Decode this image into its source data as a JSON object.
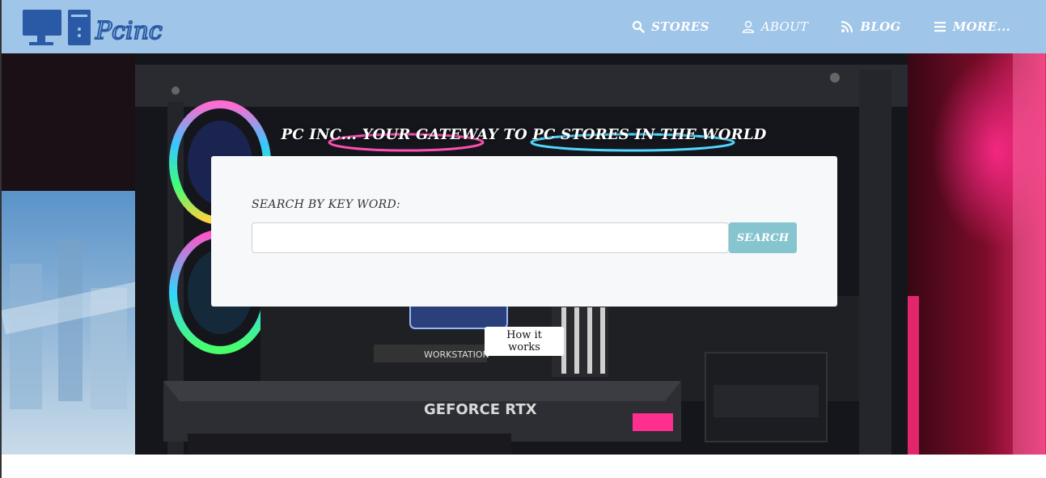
{
  "brand": {
    "logo_text": "Pcinc",
    "logo_color": "#2a5aa6"
  },
  "nav": {
    "items": [
      {
        "label": "STORES",
        "icon": "search-icon"
      },
      {
        "label": "ABOUT",
        "icon": "user-icon"
      },
      {
        "label": "BLOG",
        "icon": "rss-icon"
      },
      {
        "label": "MORE...",
        "icon": "menu-icon"
      }
    ],
    "background": "#9fc5e8"
  },
  "hero": {
    "title": "PC INC... YOUR GATEWAY TO PC STORES IN THE WORLD",
    "photo_labels": {
      "board": "WORKSTATION",
      "gpu": "GEFORCE RTX"
    }
  },
  "search": {
    "label": "SEARCH BY KEY WORD:",
    "input_value": "",
    "placeholder": "",
    "button_label": "SEARCH",
    "button_color": "#86c5d0"
  },
  "how_it_works": {
    "label": "How it works"
  }
}
